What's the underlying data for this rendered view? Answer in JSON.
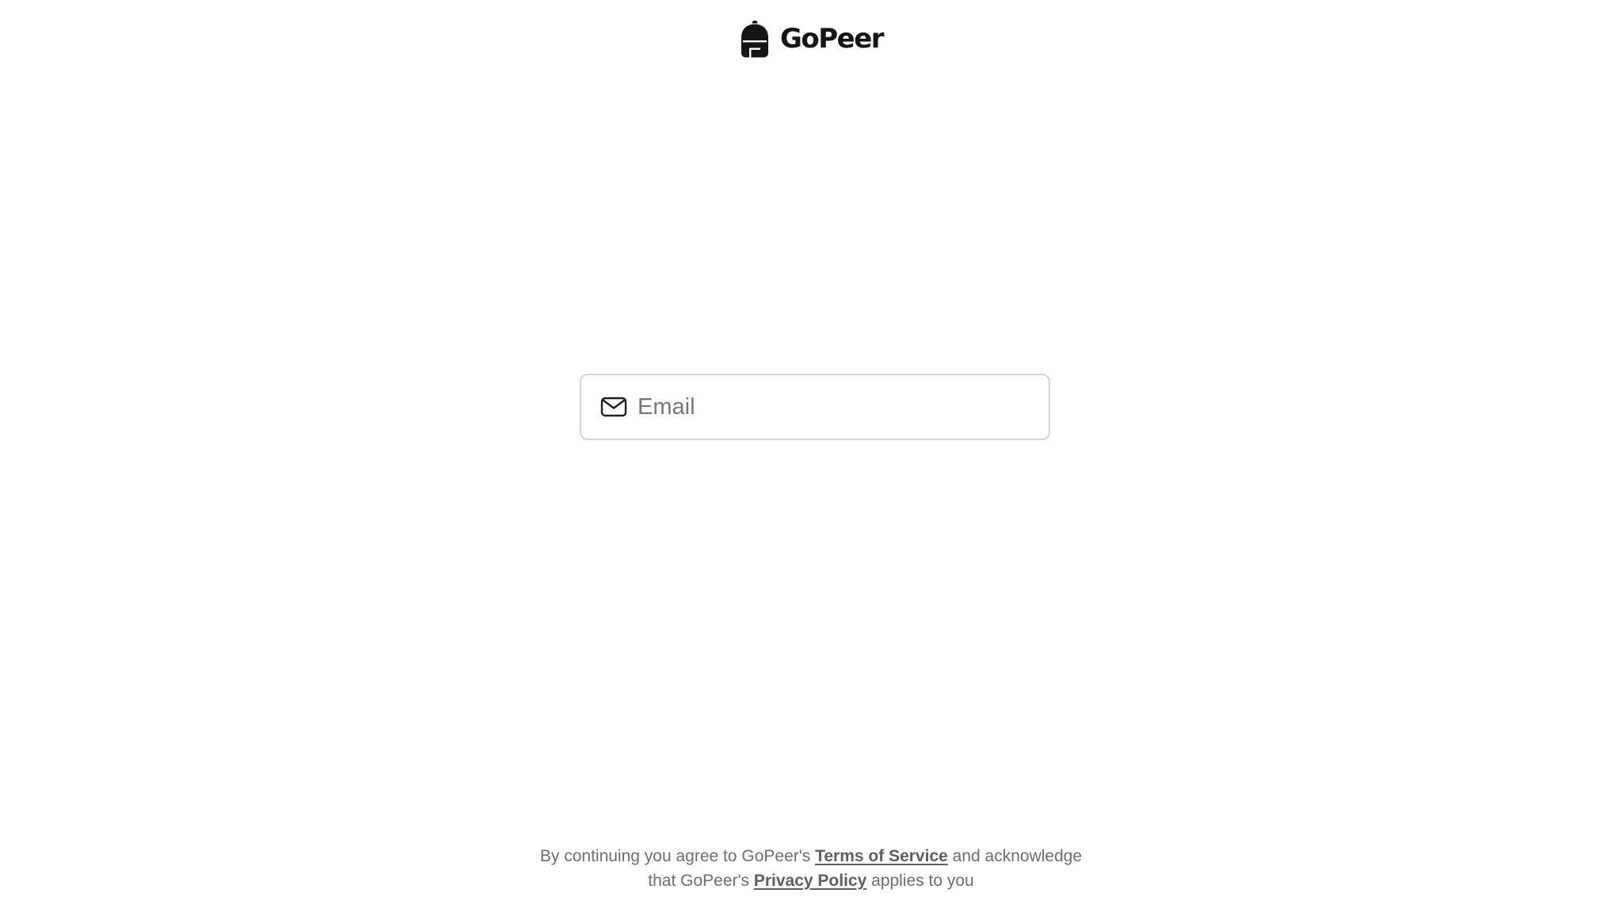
{
  "brand": {
    "name": "GoPeer",
    "logo_icon": "backpack-icon",
    "logo_color": "#151515"
  },
  "email": {
    "placeholder": "Email",
    "value": "",
    "icon": "mail-icon"
  },
  "legal": {
    "line1_prefix": "By continuing you agree to GoPeer's",
    "terms_link": "Terms of Service",
    "line1_suffix": "and acknowledge",
    "line2_prefix": "that GoPeer's",
    "privacy_link": "Privacy Policy",
    "line2_suffix": "applies to you"
  },
  "colors": {
    "background": "#ffffff",
    "field_border": "#d6d6d6",
    "legal_text": "#6d6d6d"
  }
}
